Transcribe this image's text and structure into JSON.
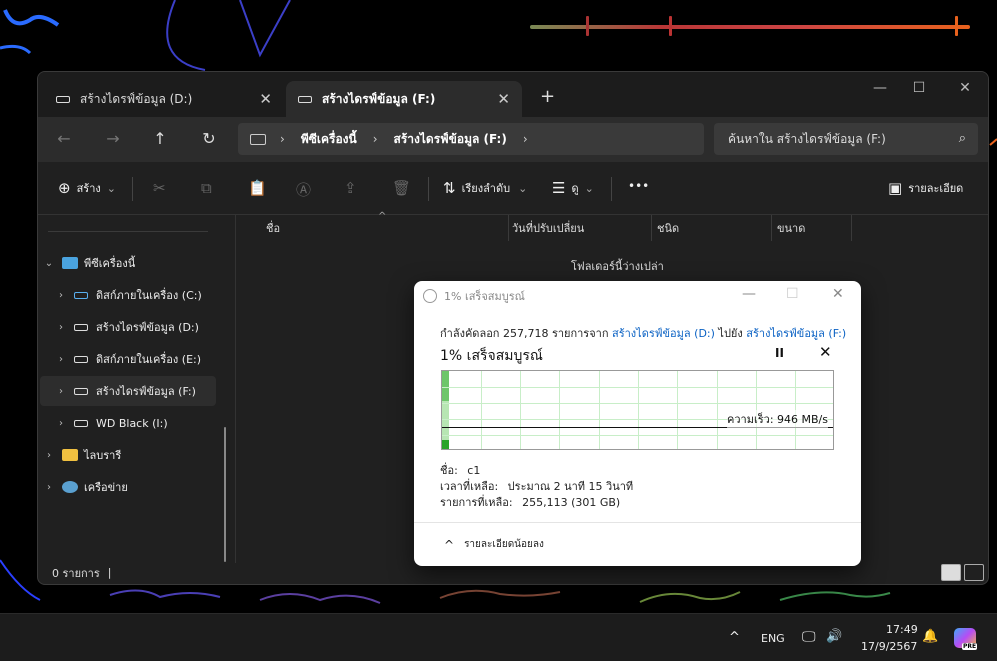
{
  "explorer": {
    "tabs": [
      {
        "label": "สร้างไดรฟ์ข้อมูล (D:)",
        "active": false
      },
      {
        "label": "สร้างไดรฟ์ข้อมูล (F:)",
        "active": true
      }
    ],
    "new_tab": "+",
    "window_controls": {
      "minimize": "—",
      "maximize": "☐",
      "close": "✕"
    },
    "nav": {
      "back": "←",
      "forward": "→",
      "up": "↑",
      "refresh": "↻",
      "expand": "›"
    },
    "breadcrumb": [
      "พีซีเครื่องนี้",
      "สร้างไดรฟ์ข้อมูล (F:)"
    ],
    "breadcrumb_sep": "›",
    "search": {
      "placeholder": "ค้นหาใน สร้างไดรฟ์ข้อมูล (F:)",
      "icon": "⌕"
    },
    "toolbar": {
      "new_label": "สร้าง",
      "sort_label": "เรียงลำดับ",
      "view_label": "ดู",
      "more": "•••",
      "details_label": "รายละเอียด",
      "dropdown": "⌄",
      "icons": {
        "new": "⊕",
        "cut": "✂",
        "copy": "⧉",
        "paste": "📋",
        "rename": "Ⓐ",
        "share": "⇪",
        "delete": "🗑",
        "sort": "⇅",
        "view": "☰",
        "details": "▣"
      }
    },
    "sidebar": {
      "chev_down": "⌄",
      "chev_right": "›",
      "items": [
        {
          "label": "พีซีเครื่องนี้"
        },
        {
          "label": "ดิสก์ภายในเครื่อง (C:)"
        },
        {
          "label": "สร้างไดรฟ์ข้อมูล (D:)"
        },
        {
          "label": "ดิสก์ภายในเครื่อง (E:)"
        },
        {
          "label": "สร้างไดรฟ์ข้อมูล (F:)"
        },
        {
          "label": "WD Black (I:)"
        },
        {
          "label": "ไลบรารี"
        },
        {
          "label": "เครือข่าย"
        }
      ]
    },
    "columns": {
      "name": "ชื่อ",
      "modified": "วันที่ปรับเปลี่ยน",
      "type": "ชนิด",
      "size": "ขนาด",
      "sort_indicator": "^"
    },
    "empty_message": "โฟลเดอร์นี้ว่างเปล่า",
    "status": "0 รายการ",
    "status_cursor": "|"
  },
  "copy_dialog": {
    "title": "1% เสร็จสมบูรณ์",
    "window_controls": {
      "minimize": "—",
      "maximize": "☐",
      "close": "✕"
    },
    "line_prefix": "กำลังคัดลอก 257,718 รายการจาก",
    "from": "สร้างไดรฟ์ข้อมูล (D:)",
    "to_word": "ไปยัง",
    "to": "สร้างไดรฟ์ข้อมูล (F:)",
    "progress_label": "1% เสร็จสมบูรณ์",
    "progress_percent": 1,
    "pause": "II",
    "cancel": "✕",
    "speed_label": "ความเร็ว: 946 MB/s",
    "name_label": "ชื่อ:",
    "name_value": "c1",
    "time_label": "เวลาที่เหลือ:",
    "time_value": "ประมาณ 2 นาที 15 วินาที",
    "items_label": "รายการที่เหลือ:",
    "items_value": "255,113 (301 GB)",
    "fewer_details": "รายละเอียดน้อยลง",
    "fewer_icon": "^"
  },
  "taskbar": {
    "chevron": "^",
    "language": "ENG",
    "icons": {
      "network": "🖵",
      "volume": "🔊",
      "bell": "🔔"
    },
    "time": "17:49",
    "date": "17/9/2567",
    "copilot_badge": "PRE"
  }
}
